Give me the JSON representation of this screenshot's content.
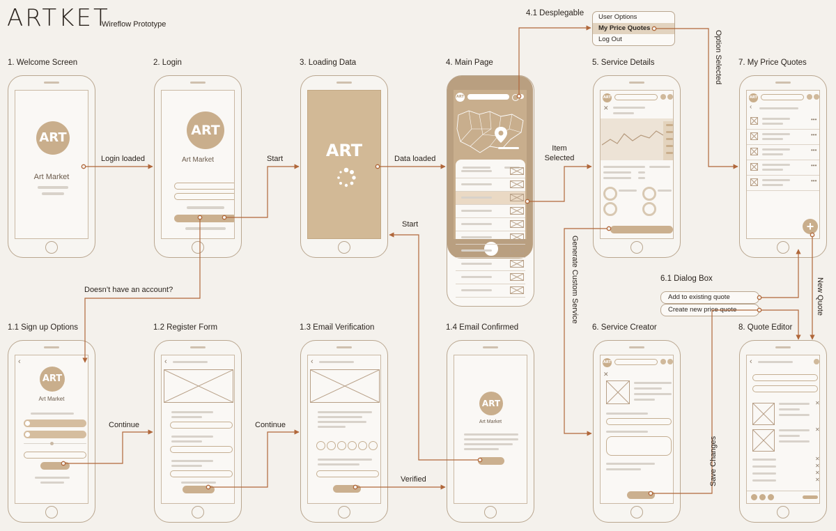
{
  "brand": {
    "name": "ARTKET",
    "subtitle": "Wireflow Prototype"
  },
  "logo": {
    "mark": "ART",
    "caption": "Art Market"
  },
  "screens": {
    "welcome": "1. Welcome Screen",
    "login": "2. Login",
    "loading": "3. Loading Data",
    "main": "4. Main Page",
    "details": "5. Service Details",
    "quotes": "7. My Price Quotes",
    "signup": "1.1 Sign up Options",
    "register": "1.2 Register Form",
    "verify": "1.3 Email Verification",
    "confirmed": "1.4 Email Confirmed",
    "creator": "6. Service Creator",
    "editor": "8. Quote Editor"
  },
  "connectors": {
    "login_loaded": "Login loaded",
    "start_1": "Start",
    "data_loaded": "Data loaded",
    "item_selected_1": "Item",
    "item_selected_2": "Selected",
    "start_2": "Start",
    "no_account": "Doesn’t have an account?",
    "continue_1": "Continue",
    "continue_2": "Continue",
    "verified": "Verified",
    "generate": "Generate Custom Service",
    "option_selected": "Option Selected",
    "new_quote": "New Quote",
    "save_changes": "Save Changes"
  },
  "dropdown": {
    "title": "4.1 Desplegable",
    "items": [
      "User Options",
      "My Price Quotes",
      "Log Out"
    ]
  },
  "dialog": {
    "title": "6.1 Dialog Box",
    "items": [
      "Add to existing quote",
      "Create new price quote"
    ]
  },
  "colors": {
    "background": "#f4f1ec",
    "accent": "#b0673a",
    "tan": "#c9ae8c",
    "outline": "#b9a68f"
  }
}
